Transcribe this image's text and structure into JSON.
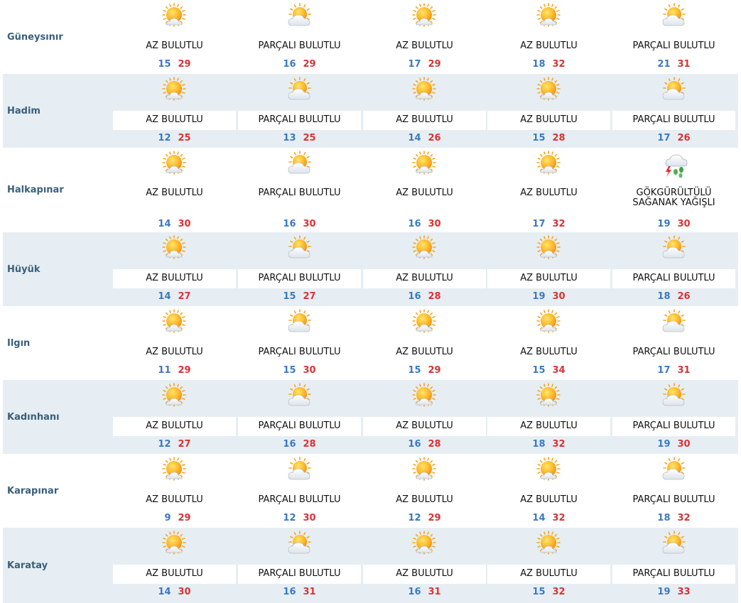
{
  "colors": {
    "min_temp": "#3b79c1",
    "max_temp": "#d73335",
    "alt_row_bg": "#e6eef3",
    "city_text": "#3a5f7a"
  },
  "rows": [
    {
      "city": "Güneysınır",
      "days": [
        {
          "icon": "sun-cloud-icon",
          "desc": [
            "AZ BULUTLU"
          ],
          "min": "15",
          "max": "29"
        },
        {
          "icon": "partly-cloudy-icon",
          "desc": [
            "PARÇALI BULUTLU"
          ],
          "min": "16",
          "max": "29"
        },
        {
          "icon": "sun-cloud-icon",
          "desc": [
            "AZ BULUTLU"
          ],
          "min": "17",
          "max": "29"
        },
        {
          "icon": "sun-cloud-icon",
          "desc": [
            "AZ BULUTLU"
          ],
          "min": "18",
          "max": "32"
        },
        {
          "icon": "partly-cloudy-icon",
          "desc": [
            "PARÇALI BULUTLU"
          ],
          "min": "21",
          "max": "31"
        }
      ]
    },
    {
      "city": "Hadim",
      "days": [
        {
          "icon": "sun-cloud-icon",
          "desc": [
            "AZ BULUTLU"
          ],
          "min": "12",
          "max": "25"
        },
        {
          "icon": "partly-cloudy-icon",
          "desc": [
            "PARÇALI BULUTLU"
          ],
          "min": "13",
          "max": "25"
        },
        {
          "icon": "sun-cloud-icon",
          "desc": [
            "AZ BULUTLU"
          ],
          "min": "14",
          "max": "26"
        },
        {
          "icon": "sun-cloud-icon",
          "desc": [
            "AZ BULUTLU"
          ],
          "min": "15",
          "max": "28"
        },
        {
          "icon": "partly-cloudy-icon",
          "desc": [
            "PARÇALI BULUTLU"
          ],
          "min": "17",
          "max": "26"
        }
      ]
    },
    {
      "city": "Halkapınar",
      "days": [
        {
          "icon": "sun-cloud-icon",
          "desc": [
            "AZ BULUTLU"
          ],
          "min": "14",
          "max": "30"
        },
        {
          "icon": "partly-cloudy-icon",
          "desc": [
            "PARÇALI BULUTLU"
          ],
          "min": "16",
          "max": "30"
        },
        {
          "icon": "sun-cloud-icon",
          "desc": [
            "AZ BULUTLU"
          ],
          "min": "16",
          "max": "30"
        },
        {
          "icon": "sun-cloud-icon",
          "desc": [
            "AZ BULUTLU"
          ],
          "min": "17",
          "max": "32"
        },
        {
          "icon": "thunderstorm-icon",
          "desc": [
            "GÖKGÜRÜLTÜLÜ",
            "SAĞANAK YAĞIŞLI"
          ],
          "min": "19",
          "max": "30"
        }
      ]
    },
    {
      "city": "Hüyük",
      "days": [
        {
          "icon": "sun-cloud-icon",
          "desc": [
            "AZ BULUTLU"
          ],
          "min": "14",
          "max": "27"
        },
        {
          "icon": "partly-cloudy-icon",
          "desc": [
            "PARÇALI BULUTLU"
          ],
          "min": "15",
          "max": "27"
        },
        {
          "icon": "sun-cloud-icon",
          "desc": [
            "AZ BULUTLU"
          ],
          "min": "16",
          "max": "28"
        },
        {
          "icon": "sun-cloud-icon",
          "desc": [
            "AZ BULUTLU"
          ],
          "min": "19",
          "max": "30"
        },
        {
          "icon": "partly-cloudy-icon",
          "desc": [
            "PARÇALI BULUTLU"
          ],
          "min": "18",
          "max": "26"
        }
      ]
    },
    {
      "city": "Ilgın",
      "days": [
        {
          "icon": "sun-cloud-icon",
          "desc": [
            "AZ BULUTLU"
          ],
          "min": "11",
          "max": "29"
        },
        {
          "icon": "partly-cloudy-icon",
          "desc": [
            "PARÇALI BULUTLU"
          ],
          "min": "15",
          "max": "30"
        },
        {
          "icon": "sun-cloud-icon",
          "desc": [
            "AZ BULUTLU"
          ],
          "min": "15",
          "max": "29"
        },
        {
          "icon": "sun-cloud-icon",
          "desc": [
            "AZ BULUTLU"
          ],
          "min": "15",
          "max": "34"
        },
        {
          "icon": "partly-cloudy-icon",
          "desc": [
            "PARÇALI BULUTLU"
          ],
          "min": "17",
          "max": "31"
        }
      ]
    },
    {
      "city": "Kadınhanı",
      "days": [
        {
          "icon": "sun-cloud-icon",
          "desc": [
            "AZ BULUTLU"
          ],
          "min": "12",
          "max": "27"
        },
        {
          "icon": "partly-cloudy-icon",
          "desc": [
            "PARÇALI BULUTLU"
          ],
          "min": "16",
          "max": "28"
        },
        {
          "icon": "sun-cloud-icon",
          "desc": [
            "AZ BULUTLU"
          ],
          "min": "16",
          "max": "28"
        },
        {
          "icon": "sun-cloud-icon",
          "desc": [
            "AZ BULUTLU"
          ],
          "min": "18",
          "max": "32"
        },
        {
          "icon": "partly-cloudy-icon",
          "desc": [
            "PARÇALI BULUTLU"
          ],
          "min": "19",
          "max": "30"
        }
      ]
    },
    {
      "city": "Karapınar",
      "days": [
        {
          "icon": "sun-cloud-icon",
          "desc": [
            "AZ BULUTLU"
          ],
          "min": "9",
          "max": "29"
        },
        {
          "icon": "partly-cloudy-icon",
          "desc": [
            "PARÇALI BULUTLU"
          ],
          "min": "12",
          "max": "30"
        },
        {
          "icon": "sun-cloud-icon",
          "desc": [
            "AZ BULUTLU"
          ],
          "min": "12",
          "max": "29"
        },
        {
          "icon": "sun-cloud-icon",
          "desc": [
            "AZ BULUTLU"
          ],
          "min": "14",
          "max": "32"
        },
        {
          "icon": "partly-cloudy-icon",
          "desc": [
            "PARÇALI BULUTLU"
          ],
          "min": "18",
          "max": "32"
        }
      ]
    },
    {
      "city": "Karatay",
      "days": [
        {
          "icon": "sun-cloud-icon",
          "desc": [
            "AZ BULUTLU"
          ],
          "min": "14",
          "max": "30"
        },
        {
          "icon": "partly-cloudy-icon",
          "desc": [
            "PARÇALI BULUTLU"
          ],
          "min": "16",
          "max": "31"
        },
        {
          "icon": "sun-cloud-icon",
          "desc": [
            "AZ BULUTLU"
          ],
          "min": "16",
          "max": "31"
        },
        {
          "icon": "sun-cloud-icon",
          "desc": [
            "AZ BULUTLU"
          ],
          "min": "15",
          "max": "32"
        },
        {
          "icon": "partly-cloudy-icon",
          "desc": [
            "PARÇALI BULUTLU"
          ],
          "min": "19",
          "max": "33"
        }
      ]
    }
  ]
}
